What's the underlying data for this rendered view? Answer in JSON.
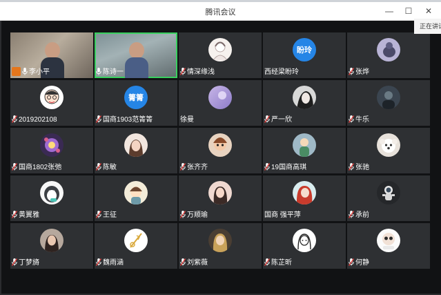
{
  "window": {
    "title": "腾讯会议",
    "minimize": "—",
    "maximize": "☐",
    "close": "✕"
  },
  "side_note": "正在讲话",
  "participants": [
    {
      "name": "李小平",
      "type": "video",
      "video": "a",
      "badge": "host",
      "mic": "on"
    },
    {
      "name": "陈诗一",
      "type": "video",
      "video": "b",
      "mic": "on",
      "active": true
    },
    {
      "name": "情深缘浅",
      "type": "avatar",
      "avatar": "sketch-girl",
      "mic": "off"
    },
    {
      "name": "西经梁盼玲",
      "type": "text",
      "avatar_text": "盼玲",
      "mic": "none"
    },
    {
      "name": "张烨",
      "type": "avatar",
      "avatar": "purple-cat",
      "mic": "off"
    },
    {
      "name": "2019202108",
      "type": "avatar",
      "avatar": "cartoon-boy",
      "mic": "off"
    },
    {
      "name": "国商1903范箐箐",
      "type": "text",
      "avatar_text": "箐箐",
      "mic": "off"
    },
    {
      "name": "徐曼",
      "type": "avatar",
      "avatar": "purple-sky",
      "mic": "none"
    },
    {
      "name": "严一欣",
      "type": "avatar",
      "avatar": "bw-girl",
      "mic": "off"
    },
    {
      "name": "牛乐",
      "type": "avatar",
      "avatar": "dark-photo",
      "mic": "off"
    },
    {
      "name": "国商1802张弛",
      "type": "avatar",
      "avatar": "purple-floral",
      "mic": "off"
    },
    {
      "name": "陈敏",
      "type": "avatar",
      "avatar": "girl-photo",
      "mic": "off"
    },
    {
      "name": "张齐齐",
      "type": "avatar",
      "avatar": "doll",
      "mic": "off"
    },
    {
      "name": "19国商高琪",
      "type": "avatar",
      "avatar": "green-figure",
      "mic": "off"
    },
    {
      "name": "张驰",
      "type": "avatar",
      "avatar": "white-dog",
      "mic": "off"
    },
    {
      "name": "黄翼雅",
      "type": "avatar",
      "avatar": "penguin",
      "mic": "off"
    },
    {
      "name": "王征",
      "type": "avatar",
      "avatar": "cartoon-girl",
      "mic": "off"
    },
    {
      "name": "万顺瑜",
      "type": "avatar",
      "avatar": "long-hair-girl",
      "mic": "off"
    },
    {
      "name": "国商  强平萍",
      "type": "avatar",
      "avatar": "red-hair",
      "mic": "none"
    },
    {
      "name": "承前",
      "type": "avatar",
      "avatar": "astronaut",
      "mic": "off"
    },
    {
      "name": "丁梦旖",
      "type": "avatar",
      "avatar": "woman-photo",
      "mic": "off"
    },
    {
      "name": "魏雨涵",
      "type": "avatar",
      "avatar": "gold-line",
      "mic": "off"
    },
    {
      "name": "刘紫薇",
      "type": "avatar",
      "avatar": "blonde-girl",
      "mic": "off"
    },
    {
      "name": "陈芷昕",
      "type": "avatar",
      "avatar": "lineart-girl",
      "mic": "off"
    },
    {
      "name": "何静",
      "type": "avatar",
      "avatar": "sticker",
      "mic": "off"
    }
  ],
  "colors": {
    "background": "#111214",
    "tile": "#2e3033",
    "active_border": "#39d05f",
    "text_avatar": "#2585e6",
    "mic_muted": "#e3403e",
    "host_badge": "#e4761c"
  }
}
